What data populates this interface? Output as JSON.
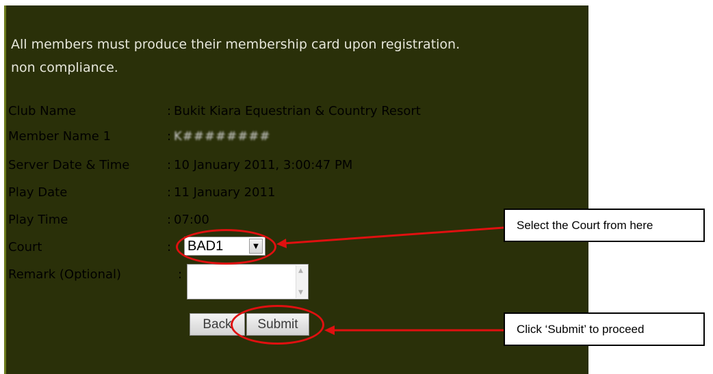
{
  "notice": {
    "line1": "All members must produce their membership card upon registration.",
    "line2": "non compliance."
  },
  "fields": {
    "club_name": {
      "label": "Club Name",
      "colon": ":",
      "value": "Bukit Kiara Equestrian & Country Resort"
    },
    "member_name": {
      "label": "Member Name 1",
      "colon": ":",
      "value": "K########"
    },
    "server_datetime": {
      "label": "Server Date & Time",
      "colon": ":",
      "value": "10 January 2011, 3:00:47 PM"
    },
    "play_date": {
      "label": "Play Date",
      "colon": ":",
      "value": "11 January 2011"
    },
    "play_time": {
      "label": "Play Time",
      "colon": ":",
      "value": "07:00"
    },
    "court": {
      "label": "Court",
      "colon": ":",
      "selected": "BAD1"
    },
    "remark": {
      "label": "Remark (Optional)",
      "colon": ":",
      "value": ""
    }
  },
  "buttons": {
    "back": "Back",
    "submit": "Submit"
  },
  "callouts": {
    "court": "Select the Court from here",
    "submit": "Click ‘Submit’ to proceed"
  },
  "colors": {
    "panel_background": "#2a3009",
    "panel_text": "#e6e6da",
    "annotation_red": "#e01010"
  },
  "icons": {
    "select_arrow": "dropdown-arrow-icon",
    "scroll_up": "scroll-up-icon",
    "scroll_down": "scroll-down-icon"
  }
}
